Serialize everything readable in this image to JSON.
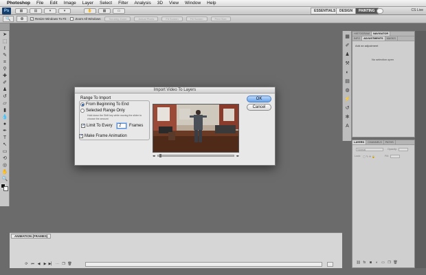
{
  "menubar": {
    "app": "Photoshop",
    "items": [
      "File",
      "Edit",
      "Image",
      "Layer",
      "Select",
      "Filter",
      "Analysis",
      "3D",
      "View",
      "Window",
      "Help"
    ]
  },
  "appbar": {
    "logo": "Ps",
    "workspaces": [
      "ESSENTIALS",
      "DESIGN",
      "PAINTING"
    ],
    "active_workspace": "PAINTING",
    "cs_live": "CS Live"
  },
  "optbar": {
    "check_resize": "Resize Windows To Fit",
    "check_zoom_all": "Zoom All Windows",
    "btn_scrubby": "Scrubby Zoom",
    "btn_actual": "Actual Pixels",
    "btn_fit": "Fit Screen",
    "btn_fill": "Fill Screen",
    "btn_print": "Print Size"
  },
  "panel_top": {
    "tabs_row1": [
      "HISTOGRAM",
      "NAVIGATOR"
    ],
    "tabs_row2": [
      "INFO",
      "ADJUSTMENTS",
      "MASKS"
    ],
    "add_adjustment": "Add an adjustment",
    "no_selection": "No selection open"
  },
  "panel_bot": {
    "tabs": [
      "LAYERS",
      "CHANNELS",
      "PATHS"
    ],
    "mode": "Normal",
    "opacity_label": "Opacity:",
    "lock_label": "Lock:",
    "fill_label": "Fill:"
  },
  "anim": {
    "tab": "ANIMATION (FRAMES)"
  },
  "dialog": {
    "title": "Import Video To Layers",
    "group_label": "Range To Import",
    "radio_all": "From Beginning To End",
    "radio_selected": "Selected Range Only",
    "help": "Hold down the Shift key while moving the slider to choose the amount",
    "limit_label": "Limit To Every",
    "limit_value": "2",
    "frames_label": "Frames",
    "make_anim": "Make Frame Animation",
    "ok": "OK",
    "cancel": "Cancel",
    "range_mode": "beginning-to-end",
    "limit_checked": true,
    "make_anim_checked": true
  },
  "colors": {
    "canvas": "#6b6b6b",
    "accent": "#2b5fb4"
  }
}
